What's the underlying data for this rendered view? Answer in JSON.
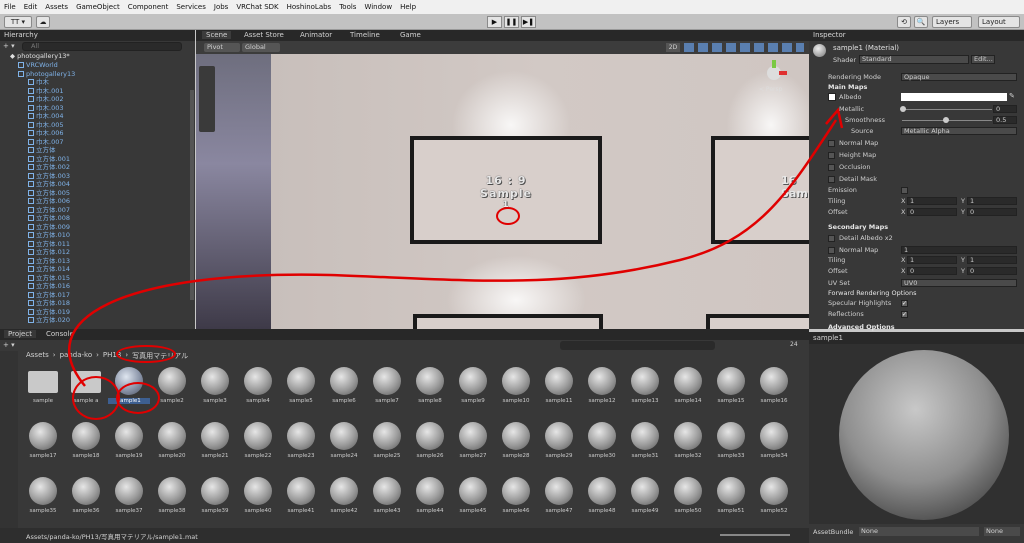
{
  "menu": [
    "File",
    "Edit",
    "Assets",
    "GameObject",
    "Component",
    "Services",
    "Jobs",
    "VRChat SDK",
    "HoshinoLabs",
    "Tools",
    "Window",
    "Help"
  ],
  "toolbar": {
    "account": "TT ▾",
    "cloud": "☁",
    "play": "▶",
    "pause": "❚❚",
    "step": "▶❚",
    "history": "⟲",
    "search": "🔍",
    "layers": "Layers",
    "layout": "Layout"
  },
  "hierarchy": {
    "tab": "Hierarchy",
    "add": "+ ▾",
    "search_placeholder": "All",
    "scene": "photogallery13*",
    "items": [
      "VRCWorld",
      "photogallery13",
      "巾木",
      "巾木.001",
      "巾木.002",
      "巾木.003",
      "巾木.004",
      "巾木.005",
      "巾木.006",
      "巾木.007",
      "立方体",
      "立方体.001",
      "立方体.002",
      "立方体.003",
      "立方体.004",
      "立方体.005",
      "立方体.006",
      "立方体.007",
      "立方体.008",
      "立方体.009",
      "立方体.010",
      "立方体.011",
      "立方体.012",
      "立方体.013",
      "立方体.014",
      "立方体.015",
      "立方体.016",
      "立方体.017",
      "立方体.018",
      "立方体.019",
      "立方体.020"
    ]
  },
  "scene_tabs": [
    "Scene",
    "Asset Store",
    "Animator",
    "Timeline",
    "Game"
  ],
  "scene_tools": {
    "pivot": "Pivot",
    "global": "Global",
    "mode2d": "2D"
  },
  "scene_view": {
    "frame1_ratio": "16 : 9",
    "frame1_name": "Sample",
    "frame1_num": "1",
    "frame2_ratio": "16",
    "frame2_name": "Samp",
    "persp": "< Persp"
  },
  "inspector": {
    "tab": "Inspector",
    "title": "sample1 (Material)",
    "shader_label": "Shader",
    "shader_value": "Standard",
    "edit": "Edit...",
    "rendering_mode_label": "Rendering Mode",
    "rendering_mode": "Opaque",
    "main_maps": "Main Maps",
    "albedo": "Albedo",
    "metallic": "Metallic",
    "metallic_val": "0",
    "smoothness": "Smoothness",
    "smoothness_val": "0.5",
    "source_label": "Source",
    "source_value": "Metallic Alpha",
    "normal_map": "Normal Map",
    "height_map": "Height Map",
    "occlusion": "Occlusion",
    "detail_mask": "Detail Mask",
    "emission": "Emission",
    "tiling": "Tiling",
    "offset": "Offset",
    "x": "X",
    "y": "Y",
    "tx": "1",
    "ty": "1",
    "ox": "0",
    "oy": "0",
    "secondary": "Secondary Maps",
    "detail_albedo": "Detail Albedo x2",
    "normal_map2": "Normal Map",
    "normal_val": "1",
    "tx2": "1",
    "ty2": "1",
    "ox2": "0",
    "oy2": "0",
    "uv_set": "UV Set",
    "uv_value": "UV0",
    "forward": "Forward Rendering Options",
    "specular": "Specular Highlights",
    "reflections": "Reflections",
    "advanced": "Advanced Options"
  },
  "preview": {
    "title": "sample1",
    "assetbundle_label": "AssetBundle",
    "assetbundle_value": "None",
    "variant": "None"
  },
  "project": {
    "tab1": "Project",
    "tab2": "Console",
    "add": "+ ▾",
    "crumbs": [
      "Assets",
      "panda-ko",
      "PH13",
      "写真用マテリアル"
    ],
    "count": "24",
    "path": "Assets/panda-ko/PH13/写真用マテリアル/sample1.mat",
    "folders": [
      "sample",
      "sample a"
    ],
    "materials": [
      "sample1",
      "sample2",
      "sample3",
      "sample4",
      "sample5",
      "sample6",
      "sample7",
      "sample8",
      "sample9",
      "sample10",
      "sample11",
      "sample12",
      "sample13",
      "sample14",
      "sample15",
      "sample16",
      "sample17",
      "sample18",
      "sample19",
      "sample20",
      "sample21",
      "sample22",
      "sample23",
      "sample24",
      "sample25",
      "sample26",
      "sample27",
      "sample28",
      "sample29",
      "sample30",
      "sample31",
      "sample32",
      "sample33",
      "sample34",
      "sample35",
      "sample36",
      "sample37",
      "sample38",
      "sample39",
      "sample40",
      "sample41",
      "sample42",
      "sample43",
      "sample44",
      "sample45",
      "sample46",
      "sample47",
      "sample48",
      "sample49",
      "sample50",
      "sample51",
      "sample52"
    ]
  }
}
